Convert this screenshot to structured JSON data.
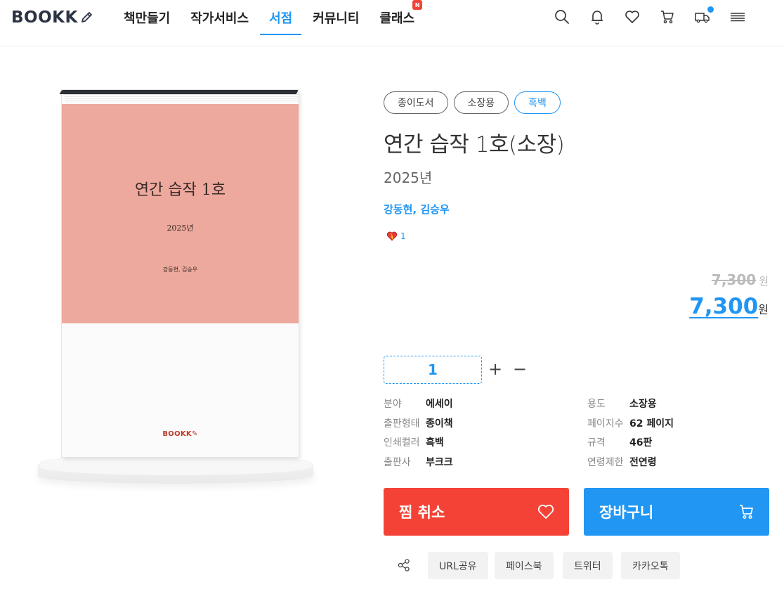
{
  "header": {
    "logo": "BOOKK",
    "nav": [
      {
        "label": "책만들기"
      },
      {
        "label": "작가서비스"
      },
      {
        "label": "서점"
      },
      {
        "label": "커뮤니티"
      },
      {
        "label": "클래스",
        "badge": "N"
      }
    ],
    "active_nav": "서점",
    "icons": [
      "search-icon",
      "bell-icon",
      "heart-icon",
      "cart-icon",
      "truck-icon",
      "menu-icon"
    ]
  },
  "book": {
    "cover_title": "연간 습작 1호",
    "cover_year": "2025년",
    "cover_authors": "강동현, 김승우",
    "cover_brand": "BOOKK",
    "cover_color": "#eda99d"
  },
  "product": {
    "tags": [
      "종이도서",
      "소장용",
      "흑백"
    ],
    "title": "연간 습작 1호(소장)",
    "subtitle": "2025년",
    "authors": "강동현, 김승우",
    "likes": "1",
    "price_original": "7,300",
    "price_sale": "7,300",
    "currency": "원",
    "quantity": "1",
    "qty_plus": "+",
    "qty_minus": "−"
  },
  "specs": {
    "left": [
      {
        "label": "분야",
        "value": "에세이"
      },
      {
        "label": "출판형태",
        "value": "종이책"
      },
      {
        "label": "인쇄컬러",
        "value": "흑백"
      },
      {
        "label": "출판사",
        "value": "부크크"
      }
    ],
    "right": [
      {
        "label": "용도",
        "value": "소장용"
      },
      {
        "label": "페이지수",
        "value": "62 페이지"
      },
      {
        "label": "규격",
        "value": "46판"
      },
      {
        "label": "연령제한",
        "value": "전연령"
      }
    ]
  },
  "actions": {
    "wishlist_cancel": "찜 취소",
    "add_to_cart": "장바구니"
  },
  "share": {
    "buttons": [
      "URL공유",
      "페이스북",
      "트위터",
      "카카오톡"
    ]
  },
  "colors": {
    "accent": "#2196f3",
    "danger": "#f44336"
  }
}
